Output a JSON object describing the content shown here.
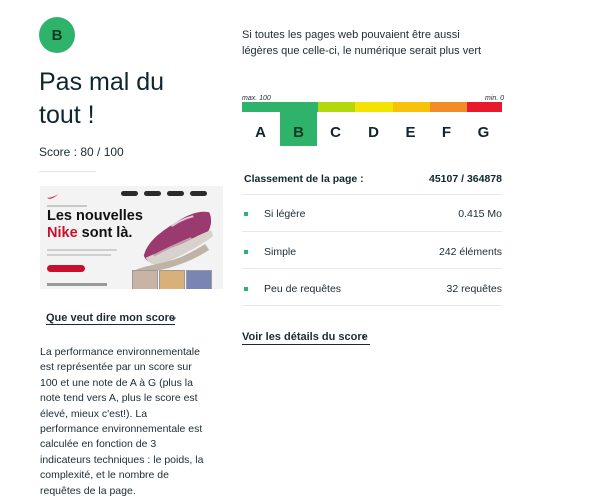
{
  "score_panel": {
    "grade": "B",
    "headline": "Pas mal du tout !",
    "score_text": "Score : 80 / 100",
    "what_link": "Que veut dire mon score",
    "explanation": "La performance environnementale est représentée par un score sur 100 et une note de A à G (plus la note tend vers A, plus le score est élevé, mieux c'est!). La performance environnementale est calculée en fonction de 3 indicateurs tech­niques : le poids, la complexité, et le nombre de requêtes de la page."
  },
  "screenshot": {
    "title_line1": "Les nouvelles",
    "title_brand": "Nike",
    "title_rest": " sont là."
  },
  "grade_scale": {
    "intro": "Si toutes les pages web pouvaient être aussi légères que celle-ci, le numérique serait plus vert",
    "max_label": "max. 100",
    "min_label": "min. 0",
    "letters": [
      "A",
      "B",
      "C",
      "D",
      "E",
      "F",
      "G"
    ],
    "selected": "B",
    "colors": [
      "#2fb36b",
      "#2fb36b",
      "#b5d70e",
      "#f2e400",
      "#f9c20a",
      "#f28c28",
      "#e8192c"
    ]
  },
  "ranking": {
    "label": "Classement de la page :",
    "value": "45107 / 364878"
  },
  "metrics": [
    {
      "label": "Si légère",
      "value": "0.415 Mo"
    },
    {
      "label": "Simple",
      "value": "242 éléments"
    },
    {
      "label": "Peu de requêtes",
      "value": "32 requêtes"
    }
  ],
  "details_link": "Voir les détails du score",
  "colors": {
    "accent_green": "#2fb36b",
    "text_dark": "#0f2630",
    "nike_red": "#c8102e"
  }
}
